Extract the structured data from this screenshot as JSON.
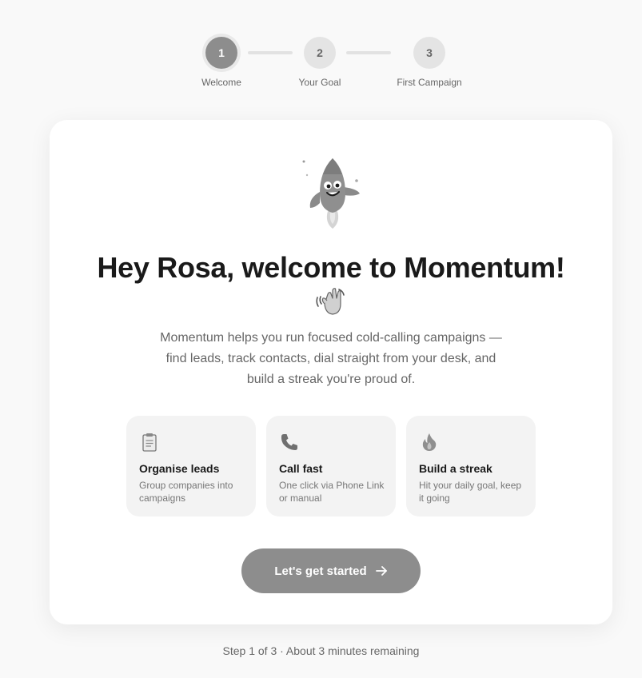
{
  "stepper": {
    "steps": [
      {
        "number": "1",
        "label": "Welcome",
        "state": "active"
      },
      {
        "number": "2",
        "label": "Your Goal",
        "state": "upcoming"
      },
      {
        "number": "3",
        "label": "First Campaign",
        "state": "upcoming"
      }
    ]
  },
  "card": {
    "illustration": "rocket-mascot-icon",
    "title": "Hey Rosa, welcome to Momentum!",
    "title_emoji": "waving-hand-icon",
    "description": "Momentum helps you run focused cold-calling campaigns — find leads, track contacts, dial straight from your desk, and build a streak you're proud of.",
    "features": [
      {
        "icon": "clipboard-icon",
        "title": "Organise leads",
        "description": "Group companies into campaigns"
      },
      {
        "icon": "phone-icon",
        "title": "Call fast",
        "description": "One click via Phone Link or manual"
      },
      {
        "icon": "flame-icon",
        "title": "Build a streak",
        "description": "Hit your daily goal, keep it going"
      }
    ],
    "cta_label": "Let's get started",
    "cta_icon": "arrow-right-icon"
  },
  "footer": {
    "progress_text": "Step 1 of 3 · About 3 minutes remaining"
  },
  "colors": {
    "background": "#f9f9f9",
    "card": "#ffffff",
    "accent": "#8d8d8d",
    "feature_bg": "#f3f3f3",
    "muted_text": "#666666"
  }
}
